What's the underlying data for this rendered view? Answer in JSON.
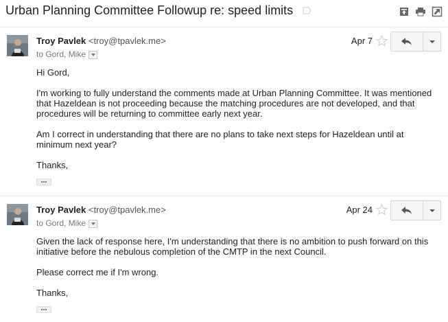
{
  "thread": {
    "subject": "Urban Planning Committee Followup re: speed limits"
  },
  "toolbar": {
    "icons": [
      "archive-icon",
      "print-icon",
      "new-window-icon"
    ]
  },
  "messages": [
    {
      "sender_name": "Troy Pavlek",
      "sender_email": "<troy@tpavlek.me>",
      "recipients": "to Gord, Mike",
      "date": "Apr 7",
      "paragraphs": [
        "Hi Gord,",
        "I'm working to fully understand the comments made at Urban Planning Committee. It was mentioned that Hazeldean is not proceeding because the matching procedures are not developed, and that procedures will be returning to committee early next year.",
        "Am I correct in understanding that there are no plans to take next steps for Hazeldean until at minimum next year?",
        "Thanks,"
      ]
    },
    {
      "sender_name": "Troy Pavlek",
      "sender_email": "<troy@tpavlek.me>",
      "recipients": "to Gord, Mike",
      "date": "Apr 24",
      "paragraphs": [
        "Given the lack of response here, I'm understanding that there is no ambition to push forward on this initiative before the nebulous completion of the CMTP in the next Council.",
        "Please correct me if I'm wrong.",
        "Thanks,"
      ]
    }
  ]
}
